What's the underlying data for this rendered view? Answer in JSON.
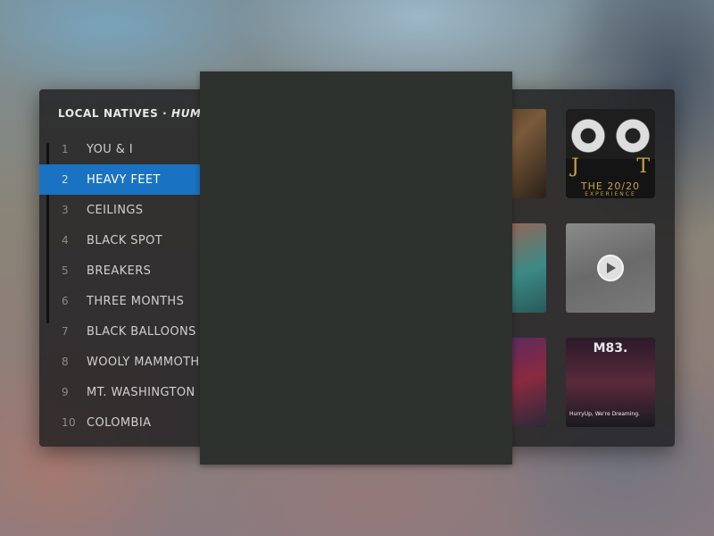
{
  "now_playing": {
    "artist": "LOCAL NATIVES",
    "separator": " · ",
    "album": "HUMMI"
  },
  "tracks": [
    {
      "num": "1",
      "title": "YOU & I",
      "active": false
    },
    {
      "num": "2",
      "title": "HEAVY FEET",
      "active": true
    },
    {
      "num": "3",
      "title": "CEILINGS",
      "active": false
    },
    {
      "num": "4",
      "title": "BLACK SPOT",
      "active": false
    },
    {
      "num": "5",
      "title": "BREAKERS",
      "active": false
    },
    {
      "num": "6",
      "title": "THREE MONTHS",
      "active": false
    },
    {
      "num": "7",
      "title": "BLACK BALLOONS",
      "active": false
    },
    {
      "num": "8",
      "title": "WOOLY MAMMOTH",
      "active": false
    },
    {
      "num": "9",
      "title": "MT. WASHINGTON",
      "active": false
    },
    {
      "num": "10",
      "title": "COLOMBIA",
      "active": false
    }
  ],
  "albums": {
    "jt": {
      "letters_left": "J",
      "letters_right": "T",
      "title": "THE 20/20",
      "subtitle": "EXPERIENCE"
    },
    "play_icon": "play-icon",
    "m83": {
      "title": "M83.",
      "subtitle": "HurryUp, We're Dreaming."
    }
  },
  "colors": {
    "accent": "#1a72c2",
    "panel": "#1e1e20",
    "sheet": "#2e322f"
  }
}
